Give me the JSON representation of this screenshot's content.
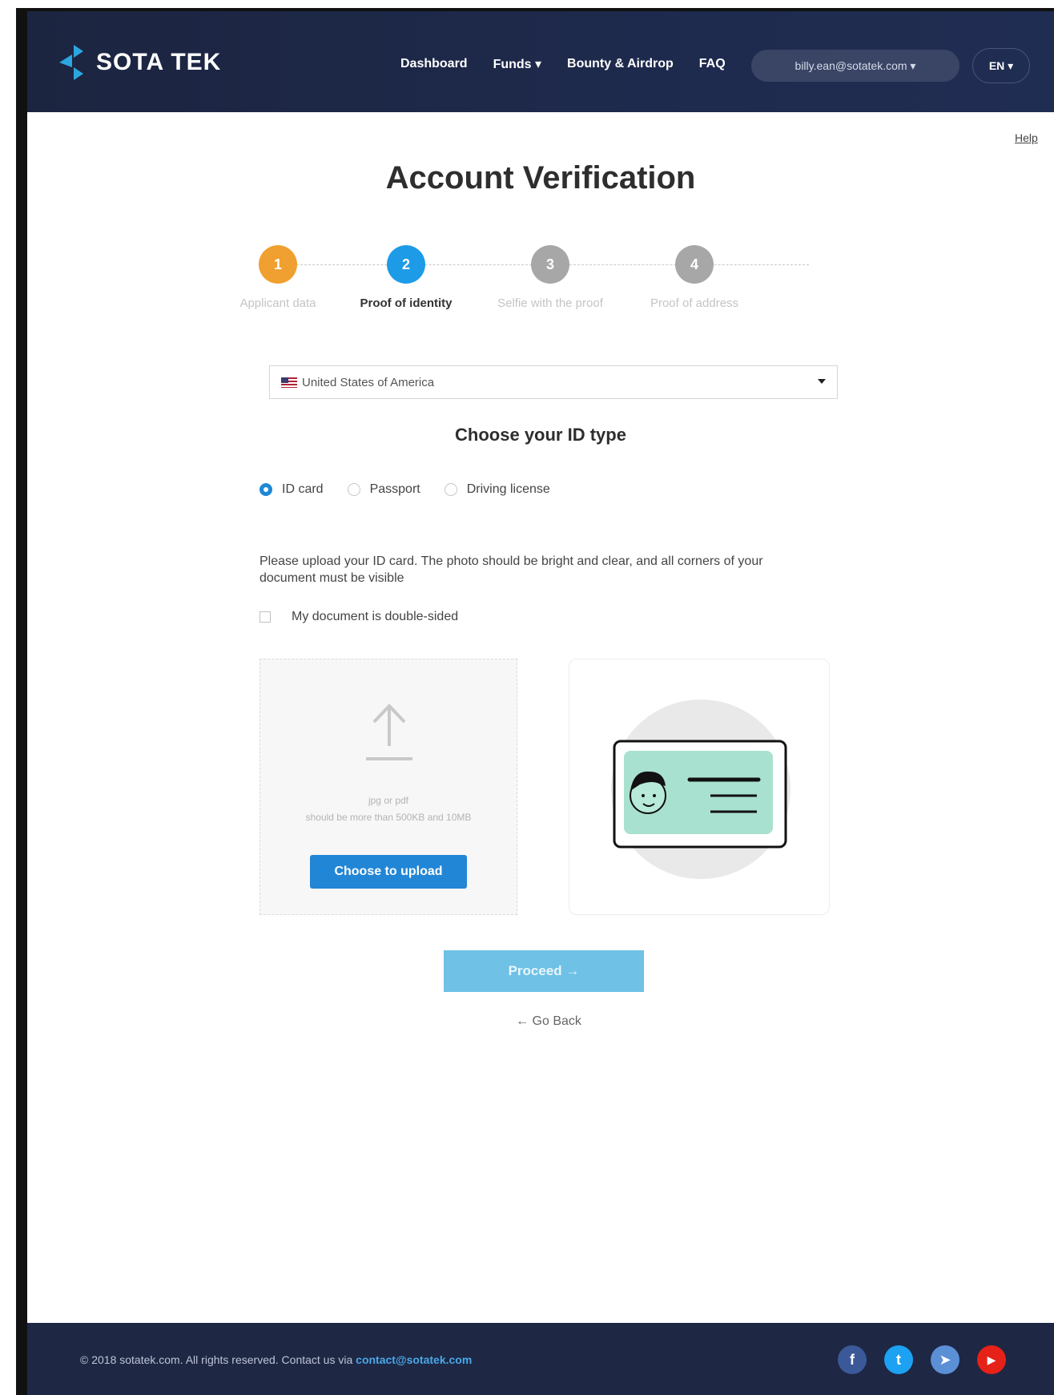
{
  "header": {
    "brand": "SOTA TEK",
    "nav": [
      {
        "label": "Dashboard"
      },
      {
        "label": "Funds ▾"
      },
      {
        "label": "Bounty & Airdrop"
      },
      {
        "label": "FAQ"
      }
    ],
    "user_email": "billy.ean@sotatek.com ▾",
    "language": "EN ▾",
    "help_link": "Help"
  },
  "page": {
    "title": "Account Verification",
    "steps": [
      {
        "number": "1",
        "label": "Applicant data",
        "state": "done",
        "color": "#f0a030"
      },
      {
        "number": "2",
        "label": "Proof of identity",
        "state": "active",
        "color": "#1e9be6"
      },
      {
        "number": "3",
        "label": "Selfie with the proof",
        "state": "pending",
        "color": "#a7a7a7"
      },
      {
        "number": "4",
        "label": "Proof of address",
        "state": "pending",
        "color": "#a7a7a7"
      }
    ],
    "country": "United States of America",
    "id_type_heading": "Choose your ID type",
    "id_types": [
      {
        "label": "ID card",
        "selected": true
      },
      {
        "label": "Passport",
        "selected": false
      },
      {
        "label": "Driving license",
        "selected": false
      }
    ],
    "instructions": "Please upload your ID card. The photo should be bright and clear, and all corners of your document must be visible",
    "double_sided_label": "My document is double-sided",
    "upload": {
      "format_hint": "jpg or pdf",
      "size_hint": "should be more than 500KB and 10MB",
      "button": "Choose to upload"
    },
    "proceed_button": "Proceed →",
    "go_back": "← Go Back"
  },
  "footer": {
    "copyright": "© 2018 sotatek.com. All rights reserved. Contact us via ",
    "contact_email": "contact@sotatek.com",
    "social": [
      {
        "name": "facebook-icon",
        "glyph": "f",
        "color": "#3b5998"
      },
      {
        "name": "twitter-icon",
        "glyph": "t",
        "color": "#1da1f2"
      },
      {
        "name": "telegram-icon",
        "glyph": "➤",
        "color": "#5b8fd6"
      },
      {
        "name": "youtube-icon",
        "glyph": "▶",
        "color": "#e62117"
      }
    ]
  },
  "colors": {
    "header_bg": "#1e2a4d",
    "accent_blue": "#2286d6",
    "step_done": "#f0a030",
    "proceed_disabled": "#6fc1e6"
  }
}
